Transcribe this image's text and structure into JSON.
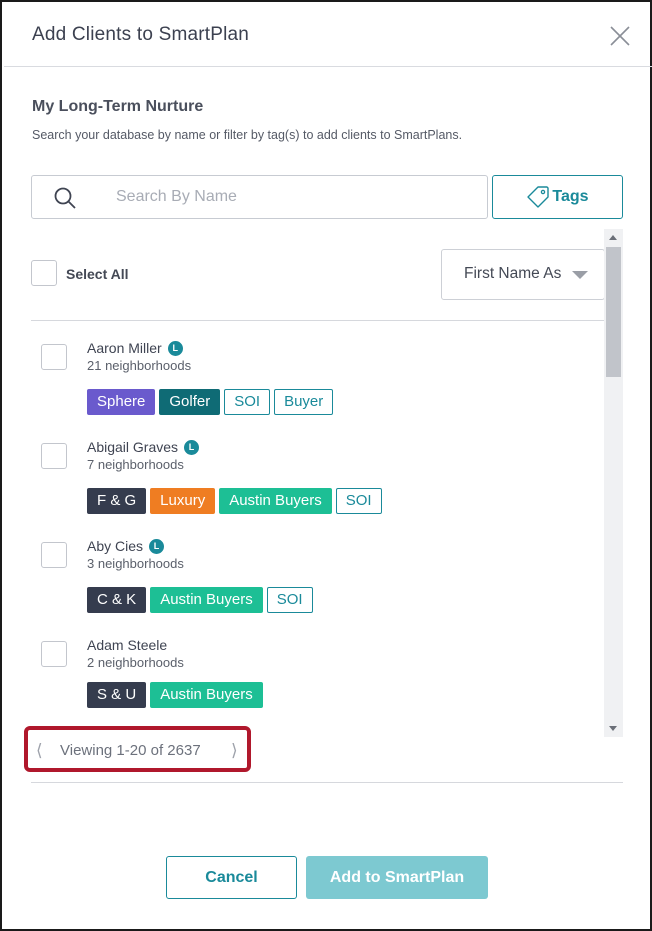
{
  "dialog": {
    "title": "Add Clients to SmartPlan",
    "subheading": "My Long-Term Nurture",
    "description": "Search your database by name or filter by tag(s) to add clients to SmartPlans."
  },
  "search": {
    "placeholder": "Search By Name",
    "value": ""
  },
  "tags_button": {
    "label": "Tags"
  },
  "list": {
    "select_all_label": "Select All",
    "sort_value": "First Name Ascending",
    "clients": [
      {
        "name": "Aaron Miller",
        "lead_badge": "L",
        "neighborhoods": "21 neighborhoods",
        "tags": [
          {
            "label": "Sphere",
            "style": "solid",
            "color": "#6a5acd"
          },
          {
            "label": "Golfer",
            "style": "solid",
            "color": "#0f6b75"
          },
          {
            "label": "SOI",
            "style": "outline",
            "color": "#1a8a9a"
          },
          {
            "label": "Buyer",
            "style": "outline",
            "color": "#1a8a9a"
          }
        ]
      },
      {
        "name": "Abigail Graves",
        "lead_badge": "L",
        "neighborhoods": "7 neighborhoods",
        "tags": [
          {
            "label": "F & G",
            "style": "solid",
            "color": "#353c4e"
          },
          {
            "label": "Luxury",
            "style": "solid",
            "color": "#ef7d22"
          },
          {
            "label": "Austin Buyers",
            "style": "solid",
            "color": "#1dbf95"
          },
          {
            "label": "SOI",
            "style": "outline",
            "color": "#1a8a9a"
          }
        ]
      },
      {
        "name": "Aby Cies",
        "lead_badge": "L",
        "neighborhoods": "3 neighborhoods",
        "tags": [
          {
            "label": "C & K",
            "style": "solid",
            "color": "#353c4e"
          },
          {
            "label": "Austin Buyers",
            "style": "solid",
            "color": "#1dbf95"
          },
          {
            "label": "SOI",
            "style": "outline",
            "color": "#1a8a9a"
          }
        ]
      },
      {
        "name": "Adam Steele",
        "lead_badge": "",
        "neighborhoods": "2 neighborhoods",
        "tags": [
          {
            "label": "S & U",
            "style": "solid",
            "color": "#353c4e"
          },
          {
            "label": "Austin Buyers",
            "style": "solid",
            "color": "#1dbf95"
          }
        ]
      }
    ]
  },
  "pagination": {
    "prev_icon": "chevron-left-icon",
    "text": "Viewing 1-20 of 2637",
    "next_icon": "chevron-right-icon"
  },
  "footer": {
    "cancel_label": "Cancel",
    "add_label": "Add to SmartPlan"
  },
  "colors": {
    "accent": "#1a8a9a",
    "add_button": "#7dc9d1",
    "highlight": "#b0182c"
  }
}
